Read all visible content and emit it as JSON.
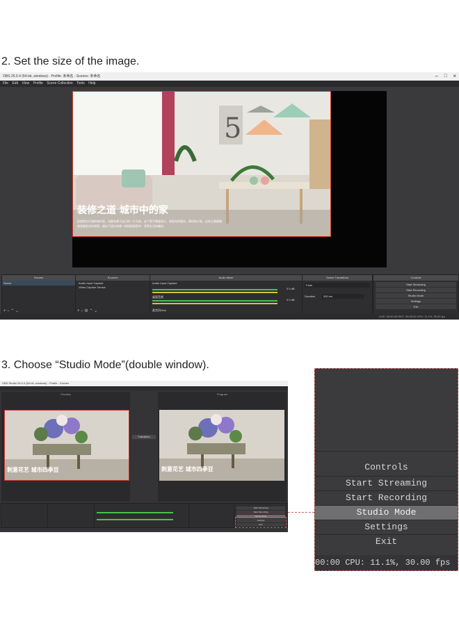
{
  "steps": {
    "step2": "2. Set the size of the image.",
    "step3": "3. Choose “Studio Mode”(double window)."
  },
  "window1": {
    "title": "OBS 25.0.4 (64-bit, windows) - Profile: 未命名 - Scenes: 未命名",
    "menu": [
      "File",
      "Edit",
      "View",
      "Profile",
      "Scene Collection",
      "Tools",
      "Help"
    ],
    "image_title": "装修之道 城市中的家",
    "image_desc_line1": "即使是在忙碌的城市里，也要有属于自己的一片天地，这个家不需要很大，有阳光的窗台，简约的沙发，还有几株植物",
    "image_desc_line2": "就是最舒适的港湾，留在下班后的第一时间回到家中，享受生活的美好。",
    "docks": {
      "scenes": "Scenes",
      "sources": "Sources",
      "mixer": "Audio Mixer",
      "transitions": "Scene Transitions",
      "controls": "Controls"
    },
    "scene_item": "Scene",
    "sources": [
      "Audio Input Capture",
      "Video Capture Device"
    ],
    "mixer_items": [
      "Audio Input Capture",
      "桌面音频",
      "麦克风/Aux"
    ],
    "db": [
      "0.0 dB",
      "0.0 dB",
      "0.0 dB"
    ],
    "transition": "Fade",
    "duration_label": "Duration",
    "duration_value": "300 ms",
    "controls": [
      "Start Streaming",
      "Start Recording",
      "Studio Mode",
      "Settings",
      "Exit"
    ],
    "status": "LIVE: 00:00:00   REC: 00:00:00   CPU: 11.1%, 30.00 fps"
  },
  "window2": {
    "title": "OBS Studio 25.0.4 (64-bit, windows) - Profile - Scenes",
    "preview_label": "Preview",
    "program_label": "Program",
    "transition_button": "Transition",
    "image_title": "刺意花艺 城市四季豆",
    "controls_short": [
      "Start Streaming",
      "Start Recording",
      "Studio Mode",
      "Settings",
      "Exit"
    ]
  },
  "zoom": {
    "heading": "Controls",
    "items": [
      "Start Streaming",
      "Start Recording",
      "Studio Mode",
      "Settings",
      "Exit"
    ],
    "status": "00:00   CPU: 11.1%, 30.00 fps"
  }
}
